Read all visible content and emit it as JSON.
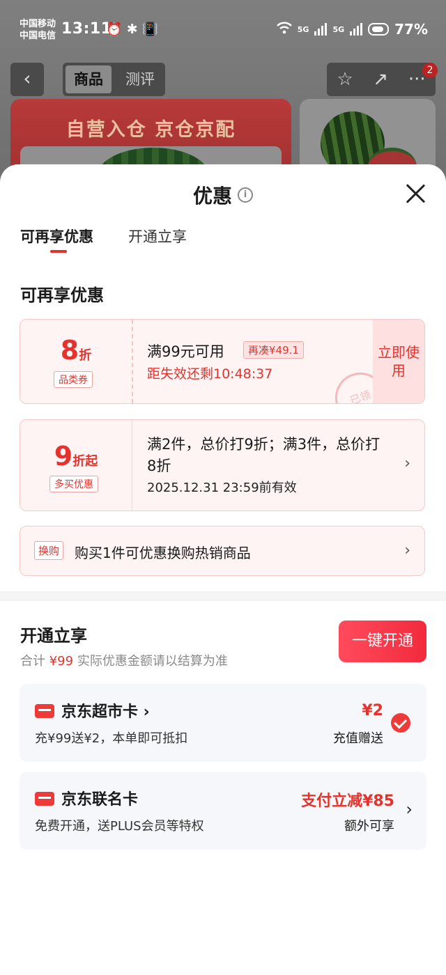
{
  "status": {
    "carrier1": "中国移动",
    "carrier2": "中国电信",
    "time": "13:11",
    "icons": "⏰ ✱ 📳",
    "wifi_icon": "wifi-icon",
    "net1": "5G",
    "net2": "5G",
    "battery": "77%"
  },
  "background_page": {
    "back_icon": "‹",
    "tab_product": "商品",
    "tab_review": "测评",
    "star_icon": "☆",
    "share_icon": "↗",
    "more_icon": "···",
    "badge": "2",
    "banner_text": "自营入仓 京仓京配"
  },
  "sheet": {
    "title": "优惠",
    "info_icon": "i",
    "tabs": [
      "可再享优惠",
      "开通立享"
    ],
    "section1": "可再享优惠",
    "coupon1": {
      "value": "8",
      "unit": "折",
      "tag": "品类券",
      "line1": "满99元可用",
      "pill": "再凑¥49.1",
      "line2": "距失效还剩10:48:37",
      "action": "立即使用",
      "stamp": "已领"
    },
    "coupon2": {
      "value": "9",
      "unit": "折起",
      "tag": "多买优惠",
      "line1": "满2件，总价打9折；满3件，总价打8折",
      "line2": "2025.12.31 23:59前有效"
    },
    "coupon3": {
      "tag": "换购",
      "text": "购买1件可优惠换购热销商品"
    },
    "section2": "开通立享",
    "summary_prefix": "合计",
    "summary_amount": "¥99",
    "summary_note": "实际优惠金额请以结算为准",
    "open_button": "一键开通",
    "cards": [
      {
        "name": "京东超市卡 ›",
        "desc": "充¥99送¥2，本单即可抵扣",
        "amount": "¥2",
        "amount_note": "充值赠送"
      },
      {
        "name": "京东联名卡",
        "desc": "免费开通，送PLUS会员等特权",
        "amount": "支付立减¥85",
        "amount_note": "额外可享"
      }
    ]
  },
  "colors": {
    "accent": "#e5322d",
    "coupon_bg": "#fff4f4",
    "card_bg": "#f6f7fa"
  }
}
